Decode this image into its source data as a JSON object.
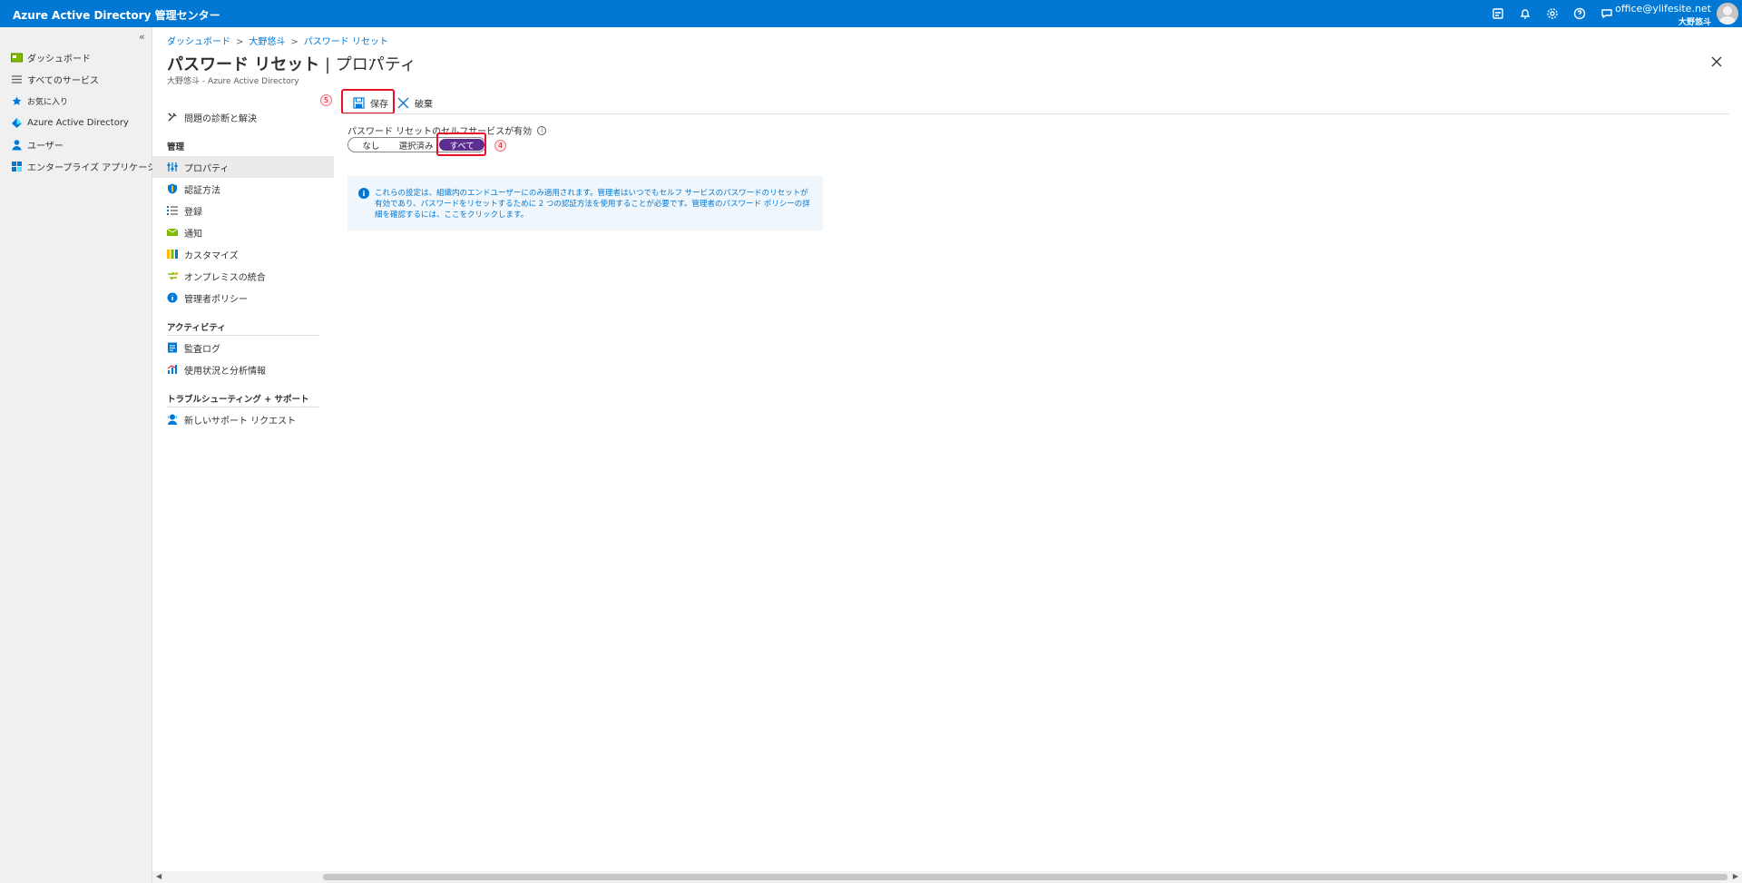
{
  "topbar": {
    "title": "Azure Active Directory 管理センター",
    "account_email": "office@ylifesite.net",
    "account_name": "大野悠斗",
    "icons": [
      "feedback-icon",
      "bell-icon",
      "gear-icon",
      "help-icon",
      "chat-icon"
    ]
  },
  "leftnav": {
    "collapse_glyph": "«",
    "items": [
      {
        "label": "ダッシュボード",
        "icon": "dashboard-icon"
      },
      {
        "label": "すべてのサービス",
        "icon": "list-icon"
      },
      {
        "label": "お気に入り",
        "icon": "star-icon"
      },
      {
        "label": "Azure Active Directory",
        "icon": "aad-icon"
      },
      {
        "label": "ユーザー",
        "icon": "user-icon"
      },
      {
        "label": "エンタープライズ アプリケーション",
        "icon": "grid-icon"
      }
    ]
  },
  "breadcrumb": [
    "ダッシュボード",
    "大野悠斗",
    "パスワード リセット"
  ],
  "page": {
    "title_main": "パスワード リセット",
    "title_sep": " | ",
    "title_sub": "プロパティ",
    "more": "···",
    "subtitle": "大野悠斗 - Azure Active Directory"
  },
  "menu": {
    "diagnose": "問題の診断と解決",
    "sections": {
      "manage": "管理",
      "activity": "アクティビティ",
      "support": "トラブルシューティング + サポート"
    },
    "manage_items": [
      {
        "label": "プロパティ",
        "icon": "properties-icon",
        "active": true
      },
      {
        "label": "認証方法",
        "icon": "shield-icon"
      },
      {
        "label": "登録",
        "icon": "registration-icon"
      },
      {
        "label": "通知",
        "icon": "notification-icon"
      },
      {
        "label": "カスタマイズ",
        "icon": "customize-icon"
      },
      {
        "label": "オンプレミスの統合",
        "icon": "onprem-icon"
      },
      {
        "label": "管理者ポリシー",
        "icon": "info-circle-icon"
      }
    ],
    "activity_items": [
      {
        "label": "監査ログ",
        "icon": "audit-log-icon"
      },
      {
        "label": "使用状況と分析情報",
        "icon": "analytics-icon"
      }
    ],
    "support_items": [
      {
        "label": "新しいサポート リクエスト",
        "icon": "support-icon"
      }
    ]
  },
  "toolbar": {
    "save_label": "保存",
    "discard_label": "破棄",
    "step_save": "5"
  },
  "content": {
    "sspr_label": "パスワード リセットのセルフサービスが有効",
    "segment_options": [
      "なし",
      "選択済み",
      "すべて"
    ],
    "selected_option": "すべて",
    "step_segment": "4",
    "info_text": "これらの設定は、組織内のエンドユーザーにのみ適用されます。管理者はいつでもセルフ サービスのパスワードのリセットが有効であり、パスワードをリセットするために 2 つの認証方法を使用することが必要です。管理者のパスワード ポリシーの詳細を確認するには、ここをクリックします。"
  },
  "colors": {
    "topbar": "#0078d4",
    "selected_segment": "#5c2e91",
    "highlight_box": "#e81123",
    "info_background": "#eff6fc"
  }
}
